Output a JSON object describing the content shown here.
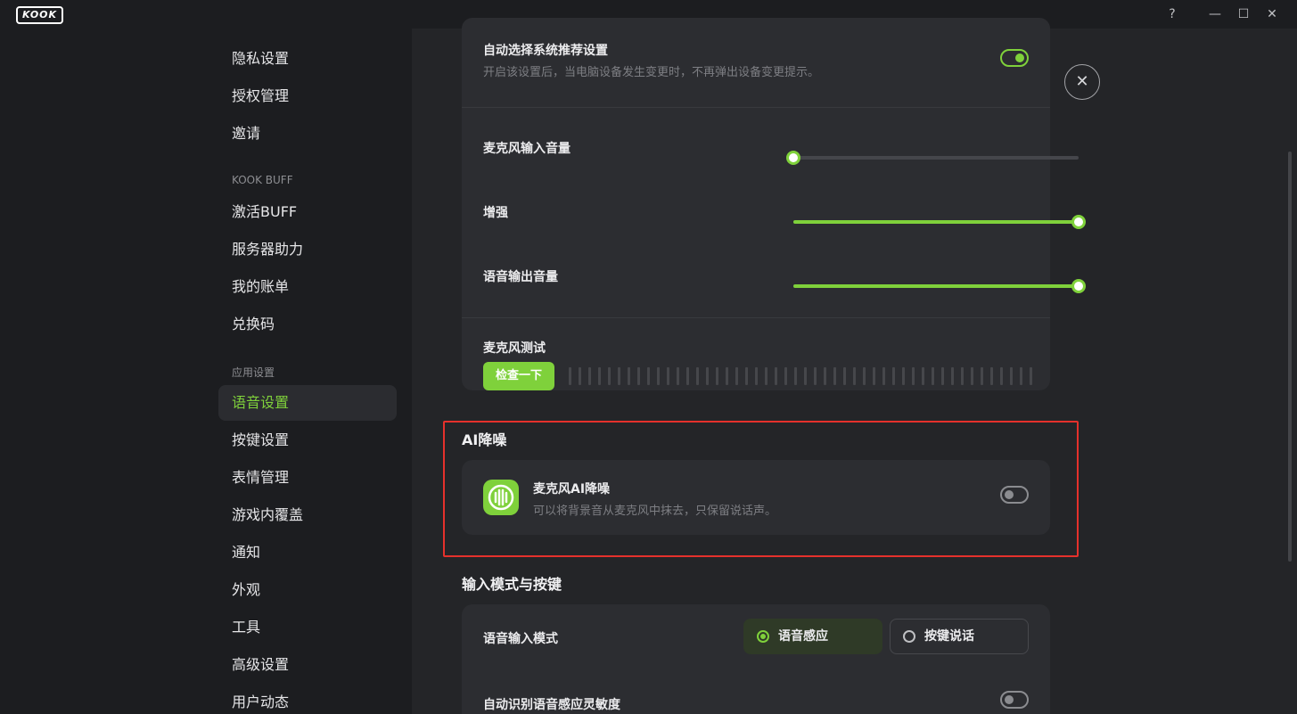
{
  "app": {
    "logo": "KOOK"
  },
  "window": {
    "help": "?",
    "minimize": "—",
    "maximize": "☐",
    "close": "✕"
  },
  "sidebar": {
    "items_top": [
      "隐私设置",
      "授权管理",
      "邀请"
    ],
    "group_buff": "KOOK BUFF",
    "items_buff": [
      "激活BUFF",
      "服务器助力",
      "我的账单",
      "兑换码"
    ],
    "group_app": "应用设置",
    "items_app": [
      "语音设置",
      "按键设置",
      "表情管理",
      "游戏内覆盖",
      "通知",
      "外观",
      "工具",
      "高级设置",
      "用户动态"
    ],
    "active": "语音设置"
  },
  "device": {
    "auto_title": "自动选择系统推荐设置",
    "auto_desc": "开启该设置后，当电脑设备发生变更时，不再弹出设备变更提示。",
    "auto_on": true,
    "mic_volume_label": "麦克风输入音量",
    "mic_volume": 0,
    "boost_label": "增强",
    "boost": 100,
    "output_label": "语音输出音量",
    "output": 100,
    "mic_test_label": "麦克风测试",
    "mic_test_button": "检查一下"
  },
  "ai_noise": {
    "section_title": "AI降噪",
    "title": "麦克风AI降噪",
    "desc": "可以将背景音从麦克风中抹去，只保留说话声。",
    "enabled": false
  },
  "input_mode": {
    "section_title": "输入模式与按键",
    "mode_label": "语音输入模式",
    "option_voice": "语音感应",
    "option_ptt": "按键说话",
    "selected": "语音感应",
    "auto_sens_label": "自动识别语音感应灵敏度",
    "auto_sens_on": false
  },
  "colors": {
    "accent": "#7fd13b",
    "highlight": "#e5312c"
  }
}
